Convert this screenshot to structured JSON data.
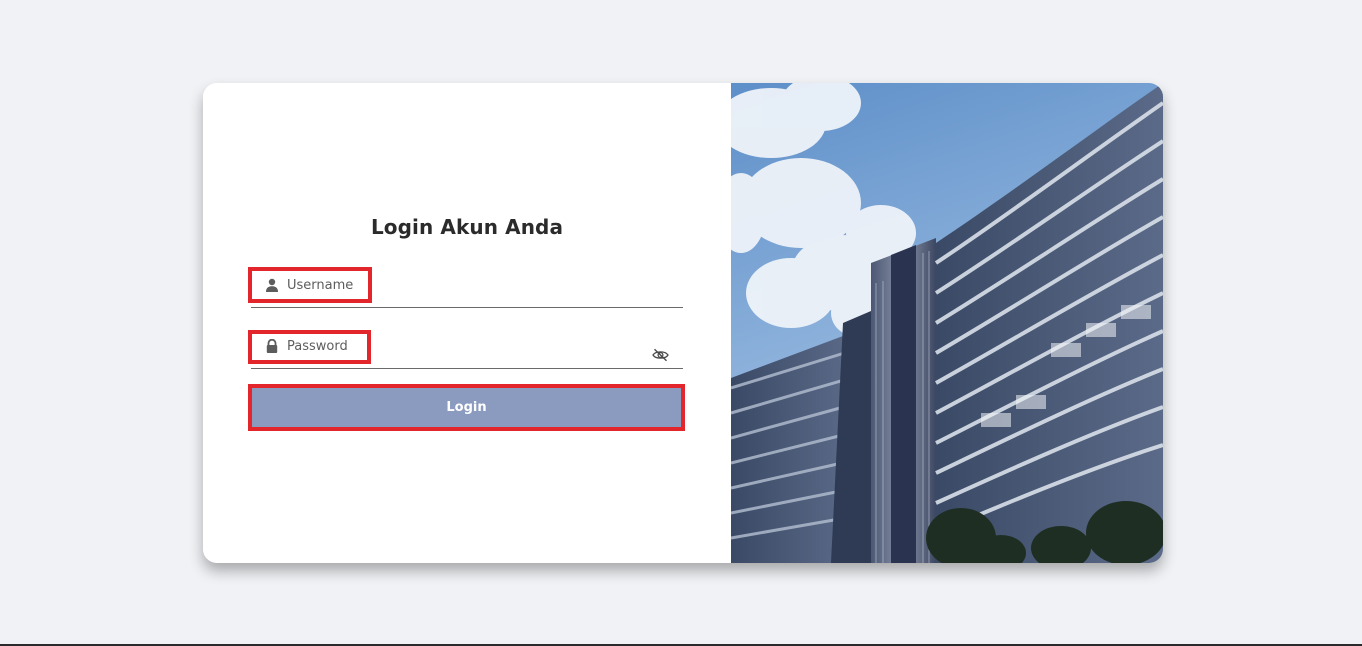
{
  "login": {
    "title": "Login Akun Anda",
    "username_placeholder": "Username",
    "password_placeholder": "Password",
    "button_label": "Login"
  },
  "icons": {
    "username": "user-icon",
    "password": "lock-icon",
    "toggle_password": "eye-off-icon"
  },
  "colors": {
    "background": "#f0f2f5",
    "button": "#8a9bbf",
    "highlight": "#e3262b"
  }
}
